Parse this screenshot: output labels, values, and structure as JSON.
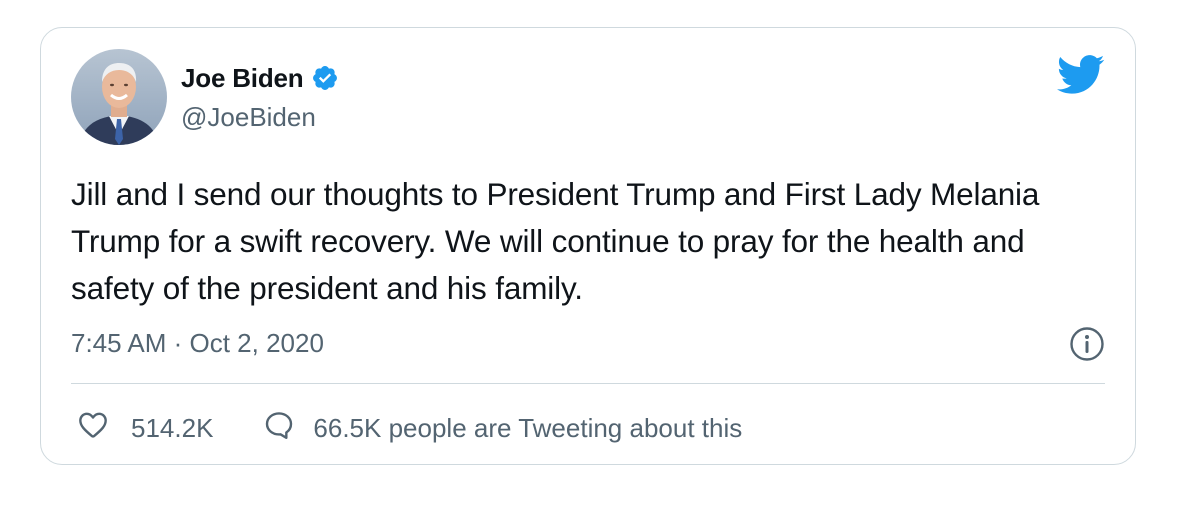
{
  "tweet": {
    "author": {
      "name": "Joe Biden",
      "handle": "@JoeBiden",
      "verified": true,
      "avatar_icon": "profile-photo"
    },
    "text": "Jill and I send our thoughts to President Trump and First Lady Melania Trump for a swift recovery. We will continue to pray for the health and safety of the president and his family.",
    "timestamp": "7:45 AM · Oct 2, 2020",
    "likes": "514.2K",
    "tweeting": "66.5K people are Tweeting about this"
  },
  "icons": {
    "brand": "twitter-bird-icon",
    "verified": "verified-badge-icon",
    "info": "info-icon",
    "like": "heart-icon",
    "reply": "speech-bubble-icon"
  },
  "colors": {
    "brand": "#1d9bf0",
    "text": "#0f1419",
    "muted": "#536471",
    "border": "#cfd9de"
  }
}
